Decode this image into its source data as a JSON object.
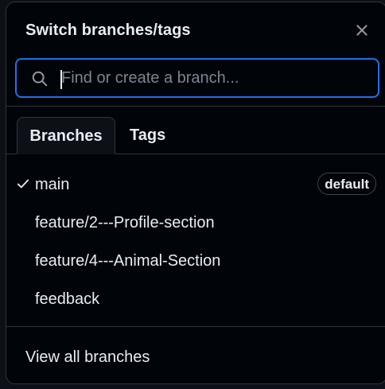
{
  "dialog": {
    "title": "Switch branches/tags",
    "close_icon": "close-icon"
  },
  "search": {
    "placeholder": "Find or create a branch...",
    "value": "",
    "icon": "search-icon"
  },
  "tabs": [
    {
      "label": "Branches",
      "active": true
    },
    {
      "label": "Tags",
      "active": false
    }
  ],
  "branches": [
    {
      "name": "main",
      "selected": true,
      "badge": "default"
    },
    {
      "name": "feature/2---Profile-section",
      "selected": false
    },
    {
      "name": "feature/4---Animal-Section",
      "selected": false
    },
    {
      "name": "feedback",
      "selected": false
    }
  ],
  "footer": {
    "link_label": "View all branches"
  },
  "colors": {
    "background": "#010409",
    "border": "#30363d",
    "accent": "#1f6feb",
    "text": "#e6edf3",
    "muted": "#7d8590"
  }
}
